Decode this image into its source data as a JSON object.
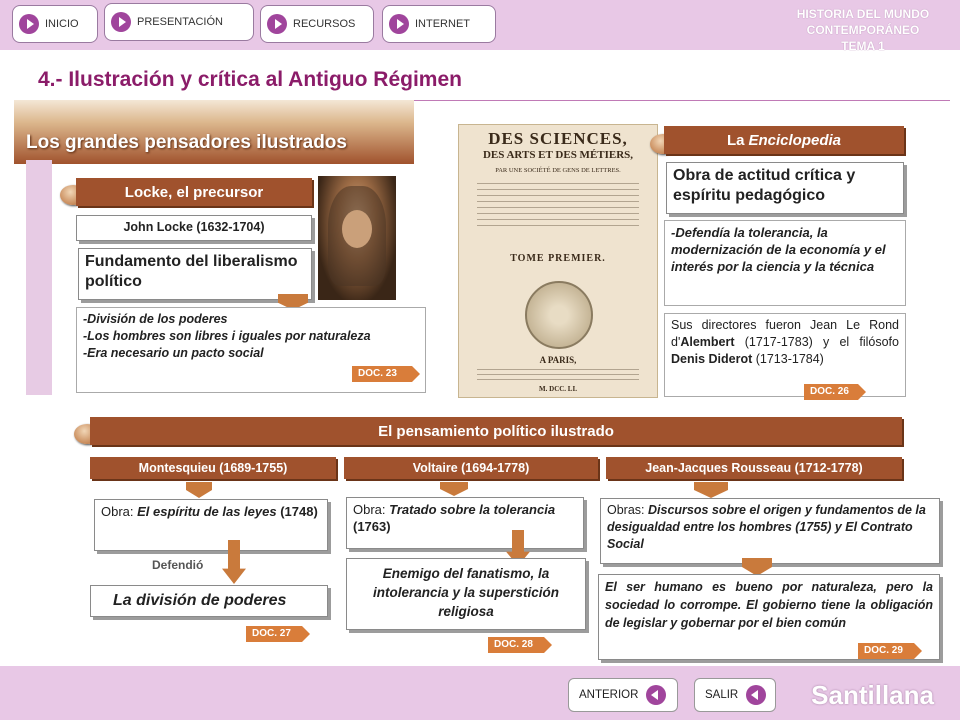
{
  "nav": {
    "inicio": "INICIO",
    "presentacion": "PRESENTACIÓN",
    "recursos": "RECURSOS",
    "internet": "INTERNET"
  },
  "course": {
    "line1": "HISTORIA DEL MUNDO CONTEMPORÁNEO",
    "line2": "TEMA 1"
  },
  "page_title": "4.- Ilustración y crítica al Antiguo Régimen",
  "section_title": "Los grandes pensadores ilustrados",
  "locke": {
    "header": "Locke, el precursor",
    "name": "John Locke (1632-1704)",
    "summary": "Fundamento del liberalismo político",
    "points": [
      "División de los poderes",
      "Los hombres son libres i iguales por naturaleza",
      "Era necesario un pacto social"
    ],
    "doc": "DOC. 23"
  },
  "frontispiece": {
    "line1": "DES SCIENCES,",
    "line2": "DES ARTS ET DES MÉTIERS,",
    "line3": "PAR UNE SOCIÉTÉ DE GENS DE LETTRES.",
    "tome": "TOME PREMIER.",
    "city": "A PARIS,",
    "year": "M. DCC. LI."
  },
  "enciclopedia": {
    "header_pre": "La ",
    "header_em": "Enciclopedia",
    "summary": "Obra de actitud crítica y espíritu pedagógico",
    "description": "Defendía la tolerancia, la modernización de la economía y el interés por la ciencia y la técnica",
    "directors_1": "Sus directores fueron Jean Le Rond d'",
    "directors_2": "Alembert",
    "directors_3": " (1717-1783) y el filósofo ",
    "directors_4": "Denis Diderot",
    "directors_5": " (1713-1784)",
    "doc": "DOC. 26"
  },
  "politico": {
    "header": "El pensamiento político ilustrado",
    "montesquieu": {
      "name": "Montesquieu (1689-1755)",
      "obra_label": "Obra: ",
      "obra": "El espíritu de las leyes",
      "year": " (1748)",
      "defendio": "Defendió",
      "result": "La división de poderes",
      "doc": "DOC. 27"
    },
    "voltaire": {
      "name": "Voltaire (1694-1778)",
      "obra_label": "Obra: ",
      "obra": "Tratado sobre la tolerancia",
      "year": " (1763)",
      "result": "Enemigo del fanatismo, la intolerancia y la superstición religiosa",
      "doc": "DOC. 28"
    },
    "rousseau": {
      "name": "Jean-Jacques Rousseau (1712-1778)",
      "obra_label": "Obras: ",
      "obra": "Discursos sobre el origen y fundamentos de la desigualdad entre los hombres (1755) y El Contrato Social",
      "result": "El ser humano es bueno por naturaleza, pero la sociedad lo corrompe. El gobierno tiene la obligación de legislar y gobernar por el bien común",
      "doc": "DOC. 29"
    }
  },
  "footer": {
    "anterior": "ANTERIOR",
    "salir": "SALIR",
    "brand": "Santillana"
  },
  "colors": {
    "accent": "#a0522d",
    "title": "#8b1c69",
    "bars": "#e8c8e6",
    "arrow": "#c97a3c"
  }
}
